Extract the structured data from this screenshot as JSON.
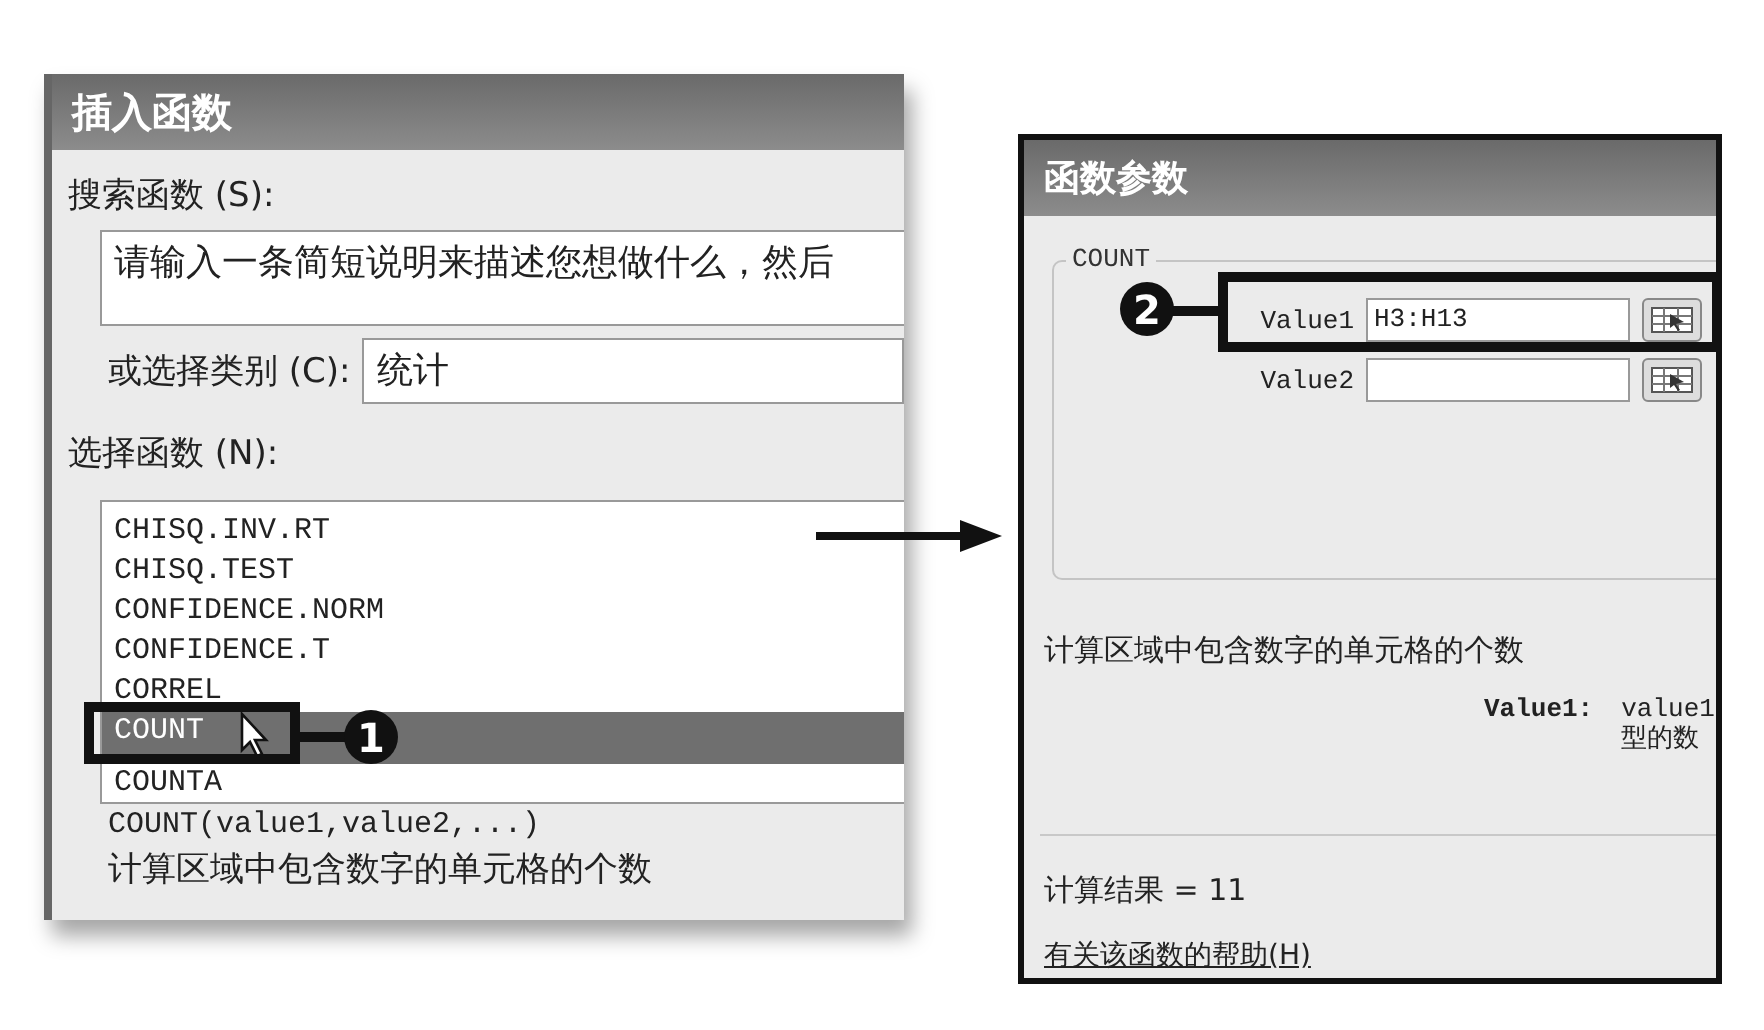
{
  "insert_function_dialog": {
    "title": "插入函数",
    "search_label": "搜索函数 (S):",
    "search_value": "请输入一条简短说明来描述您想做什么，然后",
    "category_label": "或选择类别 (C):",
    "category_value": "统计",
    "function_label": "选择函数 (N):",
    "functions": [
      {
        "name": "CHISQ.INV.RT",
        "selected": false
      },
      {
        "name": "CHISQ.TEST",
        "selected": false
      },
      {
        "name": "CONFIDENCE.NORM",
        "selected": false
      },
      {
        "name": "CONFIDENCE.T",
        "selected": false
      },
      {
        "name": "CORREL",
        "selected": false
      },
      {
        "name": "COUNT",
        "selected": true
      },
      {
        "name": "COUNTA",
        "selected": false
      }
    ],
    "syntax": "COUNT(value1,value2,...)",
    "description": "计算区域中包含数字的单元格的个数"
  },
  "callouts": [
    {
      "number": "1"
    },
    {
      "number": "2"
    }
  ],
  "function_arguments_dialog": {
    "title": "函数参数",
    "group": "COUNT",
    "arguments": [
      {
        "label": "Value1",
        "value": "H3:H13"
      },
      {
        "label": "Value2"
      }
    ],
    "description": "计算区域中包含数字的单元格的个数",
    "argument_help_label": "Value1:",
    "argument_help_text": [
      "value1",
      "型的数"
    ],
    "result": "计算结果 = 11",
    "help_link": "有关该函数的帮助(H)"
  }
}
